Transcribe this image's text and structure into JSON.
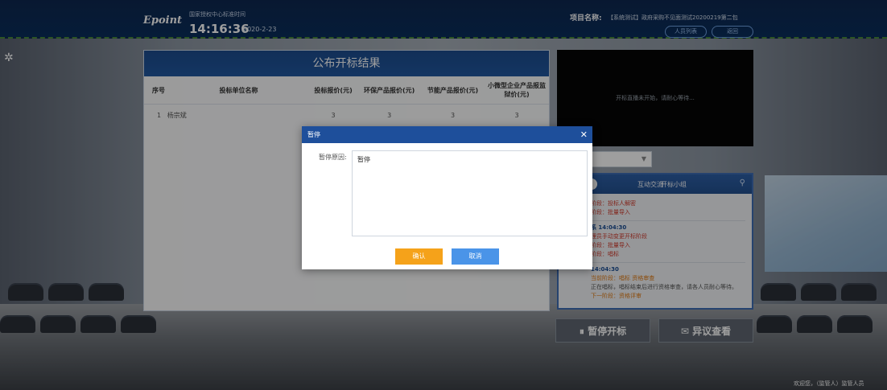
{
  "header": {
    "logo": "Epoint",
    "clock_label": "国家授权中心标准时间",
    "time": "14:16:36",
    "date": "2020-2-23",
    "project_label": "项目名称:",
    "project_name": "【系统测试】政府采购不见面测试20200219第二包",
    "btn_people": "人员列表",
    "btn_back": "返回"
  },
  "results": {
    "title": "公布开标结果",
    "columns": [
      "序号",
      "投标单位名称",
      "投标报价(元)",
      "环保产品报价(元)",
      "节能产品报价(元)",
      "小微型企业产品报监狱价(元)"
    ],
    "rows": [
      {
        "index": "1",
        "name": "杨宗斌",
        "bid": "3",
        "eco": "3",
        "energy": "3",
        "small": "3"
      }
    ]
  },
  "video": {
    "status": "开标直播未开始，请耐心等待..."
  },
  "chat": {
    "tabs": [
      "互动交流",
      "开标小组"
    ],
    "messages": [
      {
        "lines": [
          {
            "text": "阶段：投标人解密",
            "color": "red"
          },
          {
            "text": "阶段：批量导入",
            "color": "red"
          }
        ]
      },
      {
        "lines": [
          {
            "text": "系 14:04:30",
            "color": "blue"
          },
          {
            "text": "理员手动变更开标阶段",
            "color": "red"
          },
          {
            "text": "阶段：批量导入",
            "color": "red"
          },
          {
            "text": "阶段：唱标",
            "color": "red"
          }
        ]
      },
      {
        "lines": [
          {
            "text": "14:04:30",
            "color": "blue"
          },
          {
            "text": "当前阶段：唱标 资格审查",
            "color": "orange"
          },
          {
            "text": "正在唱标，唱标结束后进行资格审查，请各人员耐心等待。",
            "color": "gray"
          },
          {
            "text": "下一阶段：资格评审",
            "color": "orange"
          }
        ]
      }
    ]
  },
  "buttons": {
    "pause": "暂停开标",
    "objection": "异议查看"
  },
  "footer": {
    "user": "欢迎您，（监管人）监管人员"
  },
  "modal": {
    "title": "暂停",
    "reason_label": "暂停原因:",
    "reason_value": "暂停",
    "confirm": "确认",
    "cancel": "取消"
  },
  "colors": {
    "primary": "#1e4f9b",
    "confirm": "#f5a21a",
    "cancel": "#4a94e8"
  }
}
